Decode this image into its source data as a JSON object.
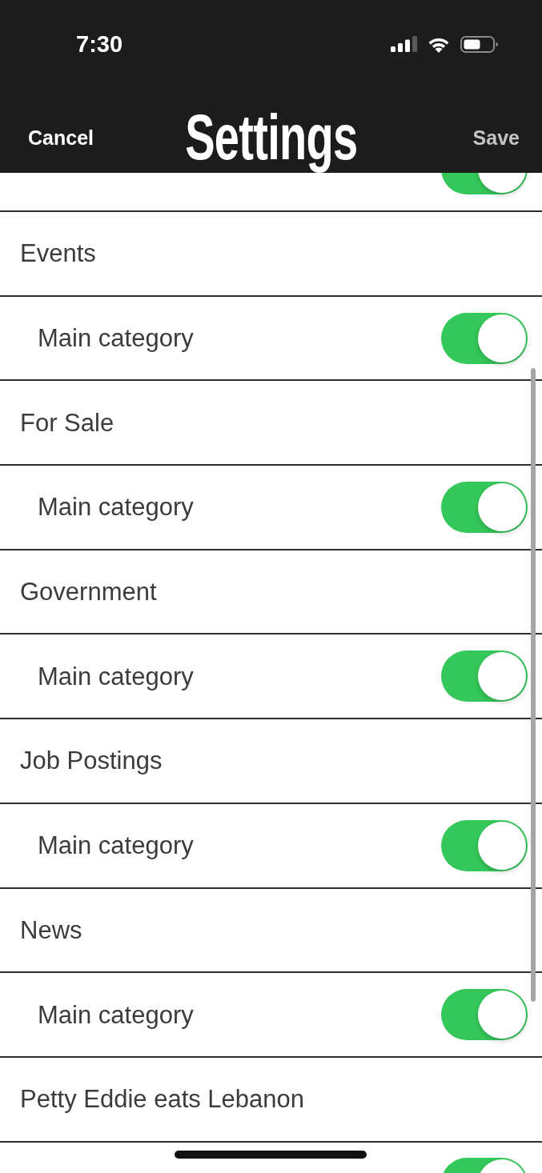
{
  "status_bar": {
    "time": "7:30"
  },
  "nav_bar": {
    "cancel": {
      "label": "Cancel"
    },
    "title": "Settings",
    "save": {
      "label": "Save",
      "disabled": true
    }
  },
  "rows": [
    {
      "kind": "toggle",
      "on": true
    },
    {
      "kind": "section",
      "label": "Events"
    },
    {
      "kind": "toggle",
      "label": "Main category",
      "on": true
    },
    {
      "kind": "section",
      "label": "For Sale"
    },
    {
      "kind": "toggle",
      "label": "Main category",
      "on": true
    },
    {
      "kind": "section",
      "label": "Government"
    },
    {
      "kind": "toggle",
      "label": "Main category",
      "on": true
    },
    {
      "kind": "section",
      "label": "Job Postings"
    },
    {
      "kind": "toggle",
      "label": "Main category",
      "on": true
    },
    {
      "kind": "section",
      "label": "News"
    },
    {
      "kind": "toggle",
      "label": "Main category",
      "on": true
    },
    {
      "kind": "section",
      "label": "Petty Eddie eats Lebanon"
    },
    {
      "kind": "toggle",
      "on": true
    }
  ]
}
